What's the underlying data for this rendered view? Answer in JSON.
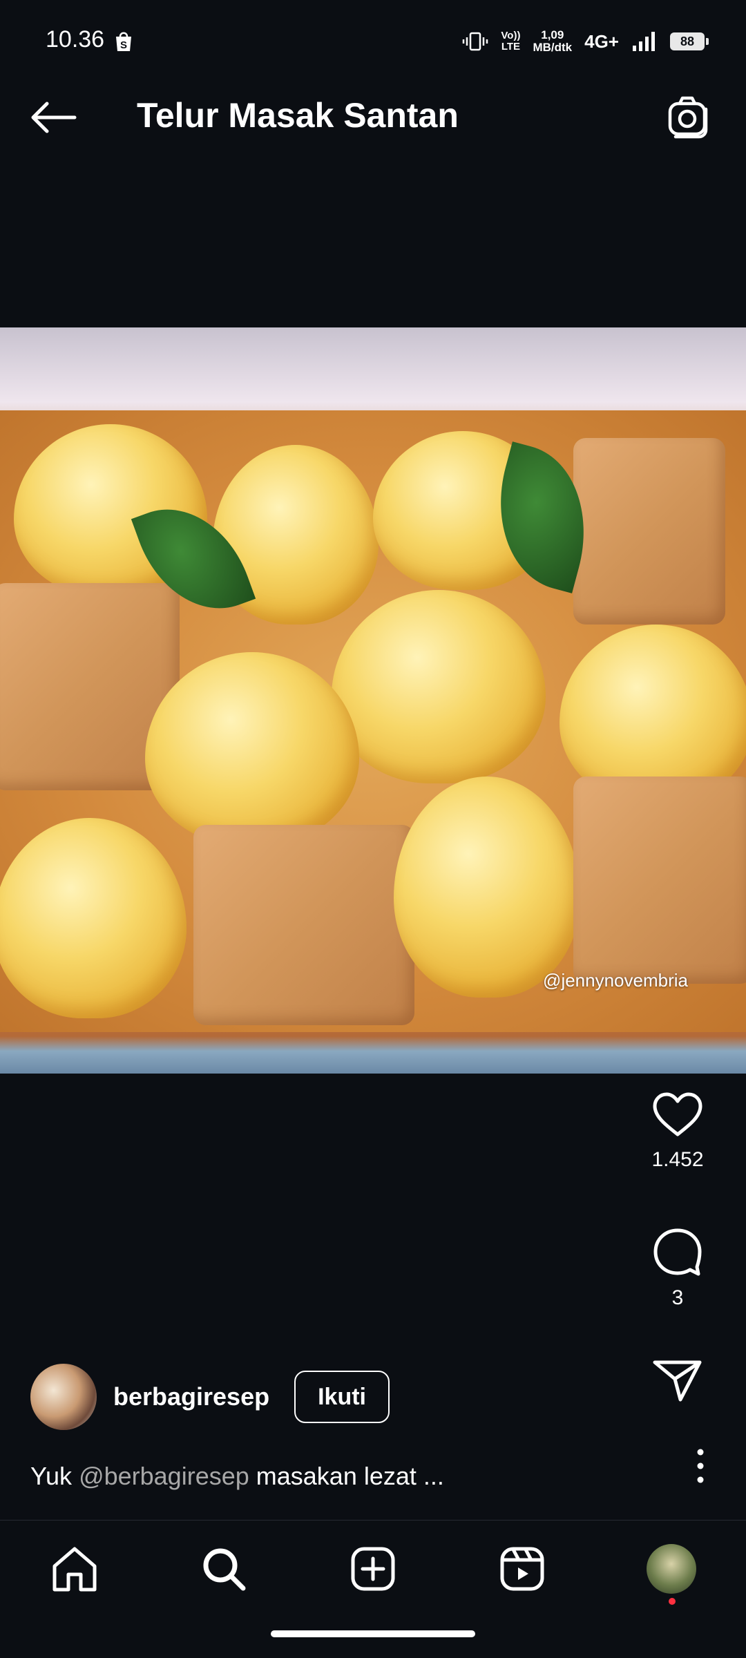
{
  "status_bar": {
    "time": "10.36",
    "volte_top": "Vo))",
    "volte_bottom": "LTE",
    "speed_value": "1,09",
    "speed_unit": "MB/dtk",
    "network": "4G+",
    "battery": "88",
    "icons": [
      "shopee-icon",
      "vibrate-icon",
      "signal-icon",
      "battery-icon"
    ]
  },
  "header": {
    "title": "Telur Masak Santan",
    "icons": [
      "back-arrow-icon",
      "camera-icon"
    ]
  },
  "media": {
    "watermark": "@jennynovembria"
  },
  "actions": {
    "likes": "1.452",
    "comments": "3",
    "icons": [
      "heart-icon",
      "comment-icon",
      "send-icon",
      "more-vertical-icon"
    ]
  },
  "post": {
    "username": "berbagiresep",
    "follow_label": "Ikuti",
    "caption_prefix": "Yuk ",
    "caption_mention": "@berbagiresep",
    "caption_rest": " masakan lezat ..."
  },
  "bottom_nav": {
    "items": [
      "home-icon",
      "search-icon",
      "add-post-icon",
      "reels-icon",
      "profile-avatar"
    ]
  },
  "colors": {
    "background": "#0b0e13",
    "text": "#ffffff",
    "mention": "#a8a8a8",
    "notification": "#ff3040"
  }
}
